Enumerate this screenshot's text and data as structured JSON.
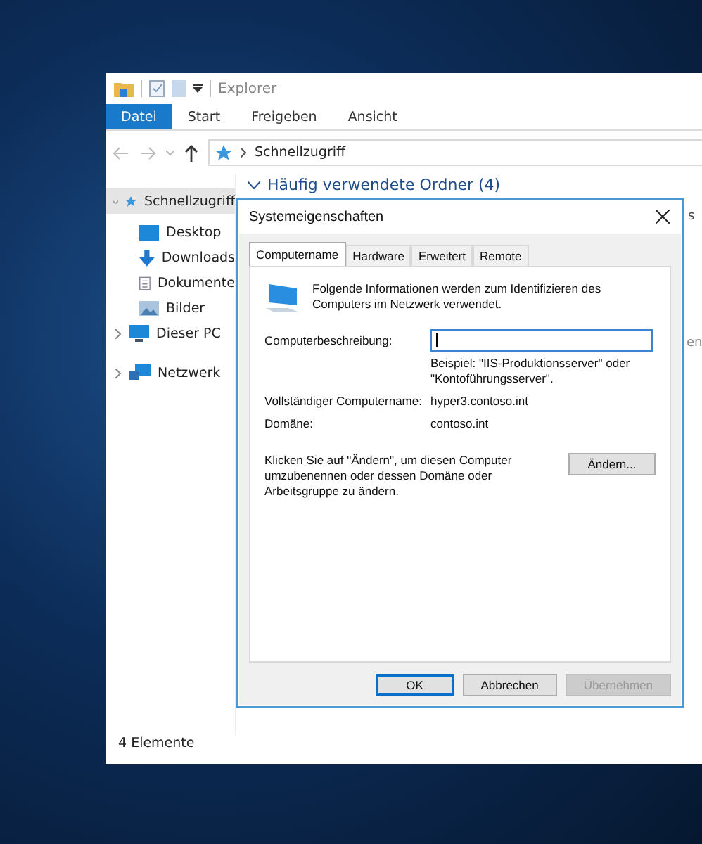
{
  "explorer": {
    "title": "Explorer",
    "ribbon_tabs": [
      {
        "label": "Datei",
        "selected": true
      },
      {
        "label": "Start",
        "selected": false
      },
      {
        "label": "Freigeben",
        "selected": false
      },
      {
        "label": "Ansicht",
        "selected": false
      }
    ],
    "address": "Schnellzugriff",
    "nav": [
      {
        "label": "Schnellzugriff",
        "selected": true,
        "expanded": true,
        "children": [
          {
            "label": "Desktop"
          },
          {
            "label": "Downloads"
          },
          {
            "label": "Dokumente"
          },
          {
            "label": "Bilder"
          }
        ]
      },
      {
        "label": "Dieser PC",
        "selected": false,
        "expanded": false
      },
      {
        "label": "Netzwerk",
        "selected": false,
        "expanded": false
      }
    ],
    "section_header": "Häufig verwendete Ordner (4)",
    "fragments": [
      "s",
      "en"
    ],
    "status": "4 Elemente"
  },
  "dialog": {
    "title": "Systemeigenschaften",
    "tabs": [
      {
        "label": "Computername",
        "selected": true
      },
      {
        "label": "Hardware",
        "selected": false
      },
      {
        "label": "Erweitert",
        "selected": false
      },
      {
        "label": "Remote",
        "selected": false
      }
    ],
    "intro": "Folgende Informationen werden zum Identifizieren des Computers im Netzwerk verwendet.",
    "description_label": "Computerbeschreibung:",
    "description_example": "Beispiel: \"IIS-Produktionsserver\" oder \"Kontoführungsserver\".",
    "fullname_label": "Vollständiger Computername:",
    "fullname_value": "hyper3.contoso.int",
    "domain_label": "Domäne:",
    "domain_value": "contoso.int",
    "change_text": "Klicken Sie auf \"Ändern\", um diesen Computer umzubenennen oder dessen Domäne oder Arbeitsgruppe zu ändern.",
    "change_button": "Ändern...",
    "buttons": [
      {
        "label": "OK",
        "kind": "default",
        "disabled": false
      },
      {
        "label": "Abbrechen",
        "kind": "normal",
        "disabled": false
      },
      {
        "label": "Übernehmen",
        "kind": "normal",
        "disabled": true
      }
    ]
  }
}
